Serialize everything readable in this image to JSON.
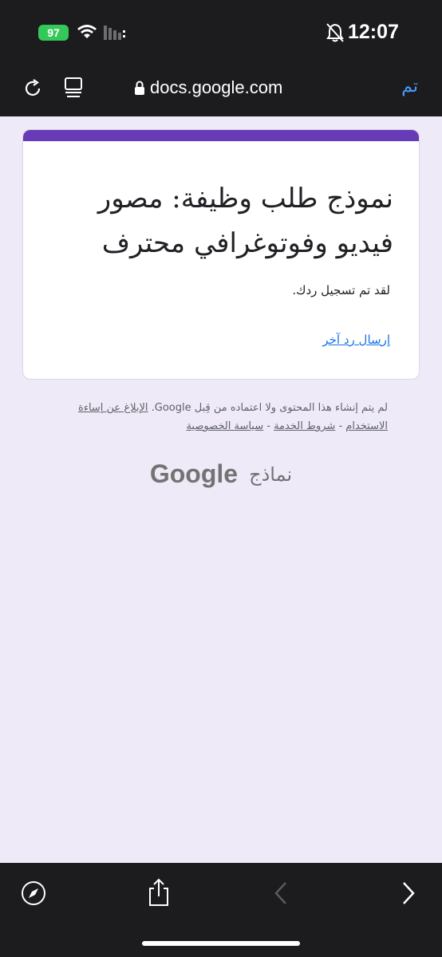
{
  "status": {
    "battery": "97",
    "time": "12:07"
  },
  "browser": {
    "url": "docs.google.com",
    "done_label": "تم"
  },
  "form": {
    "title": "نموذج طلب وظيفة: مصور فيديو وفوتوغرافي محترف",
    "confirmation": "لقد تم تسجيل ردك.",
    "submit_another": "إرسال رد آخر"
  },
  "footer": {
    "disclaimer": "لم يتم إنشاء هذا المحتوى ولا اعتماده من قِبل Google.",
    "report_abuse": "الإبلاغ عن إساءة الاستخدام",
    "terms": "شروط الخدمة",
    "privacy": "سياسة الخصوصية",
    "separator": " - ",
    "brand_google": "Google",
    "brand_forms": "نماذج"
  },
  "colors": {
    "accent": "#673ab7",
    "link": "#1a73e8",
    "background": "#efeaf8",
    "chrome": "#1c1c1e"
  },
  "icons": [
    "battery-icon",
    "wifi-icon",
    "signal-icon",
    "bell-off-icon",
    "reload-icon",
    "reader-icon",
    "lock-icon",
    "compass-icon",
    "share-icon",
    "back-icon",
    "forward-icon"
  ]
}
